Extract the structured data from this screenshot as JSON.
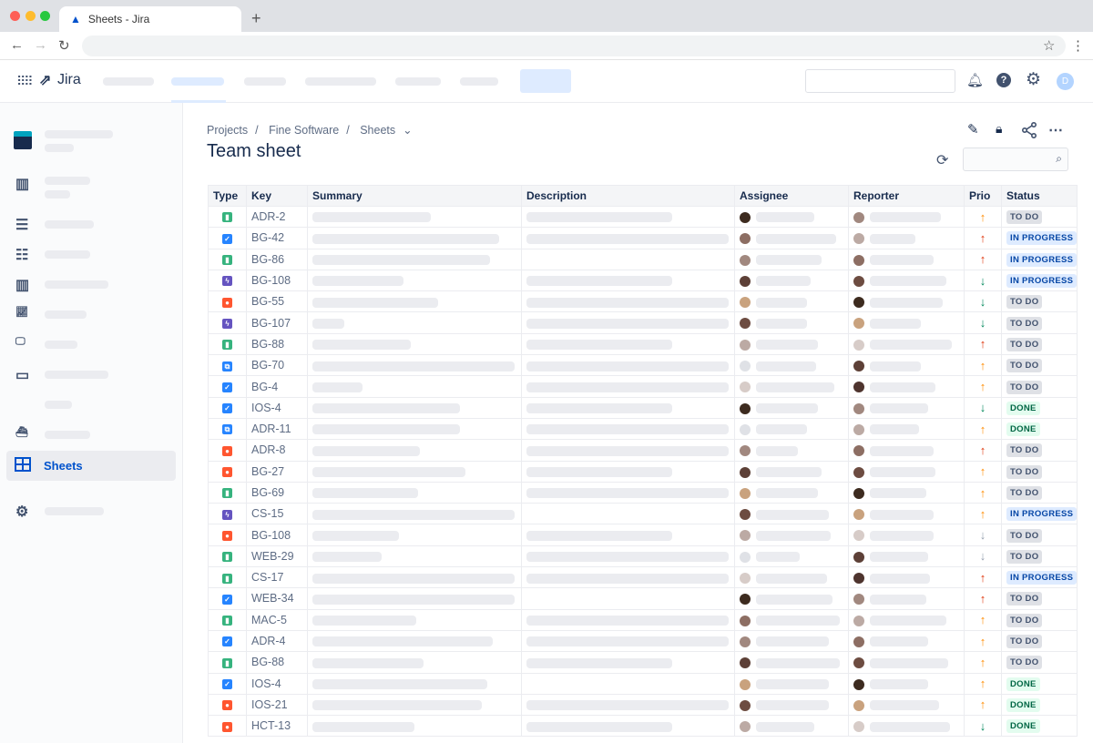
{
  "browser": {
    "tab_title": "Sheets - Jira",
    "new_tab": "+"
  },
  "app": {
    "name": "Jira",
    "avatar_initial": "D"
  },
  "sidebar": {
    "active_label": "Sheets"
  },
  "breadcrumb": {
    "items": [
      "Projects",
      "Fine Software",
      "Sheets"
    ]
  },
  "page": {
    "title": "Team sheet"
  },
  "table": {
    "columns": [
      "Type",
      "Key",
      "Summary",
      "Description",
      "Assignee",
      "Reporter",
      "Prio",
      "Status"
    ],
    "rows": [
      {
        "type": "story",
        "key": "ADR-2",
        "prio": "high",
        "status": "TO DO",
        "desc": true
      },
      {
        "type": "task",
        "key": "BG-42",
        "prio": "highest",
        "status": "IN PROGRESS",
        "desc": true
      },
      {
        "type": "story",
        "key": "BG-86",
        "prio": "highest",
        "status": "IN PROGRESS",
        "desc": false
      },
      {
        "type": "epic",
        "key": "BG-108",
        "prio": "low",
        "status": "IN PROGRESS",
        "desc": true
      },
      {
        "type": "bug",
        "key": "BG-55",
        "prio": "low",
        "status": "TO DO",
        "desc": true
      },
      {
        "type": "epic",
        "key": "BG-107",
        "prio": "low",
        "status": "TO DO",
        "desc": true
      },
      {
        "type": "story",
        "key": "BG-88",
        "prio": "highest",
        "status": "TO DO",
        "desc": true
      },
      {
        "type": "subtask",
        "key": "BG-70",
        "prio": "high",
        "status": "TO DO",
        "desc": true
      },
      {
        "type": "task",
        "key": "BG-4",
        "prio": "high",
        "status": "TO DO",
        "desc": true
      },
      {
        "type": "task",
        "key": "IOS-4",
        "prio": "low",
        "status": "DONE",
        "desc": true
      },
      {
        "type": "subtask",
        "key": "ADR-11",
        "prio": "high",
        "status": "DONE",
        "desc": true
      },
      {
        "type": "bug",
        "key": "ADR-8",
        "prio": "highest",
        "status": "TO DO",
        "desc": true
      },
      {
        "type": "bug",
        "key": "BG-27",
        "prio": "high",
        "status": "TO DO",
        "desc": true
      },
      {
        "type": "story",
        "key": "BG-69",
        "prio": "high",
        "status": "TO DO",
        "desc": true
      },
      {
        "type": "epic",
        "key": "CS-15",
        "prio": "high",
        "status": "IN PROGRESS",
        "desc": false
      },
      {
        "type": "bug",
        "key": "BG-108",
        "prio": "lowest",
        "status": "TO DO",
        "desc": true
      },
      {
        "type": "story",
        "key": "WEB-29",
        "prio": "lowest",
        "status": "TO DO",
        "desc": true
      },
      {
        "type": "story",
        "key": "CS-17",
        "prio": "highest",
        "status": "IN PROGRESS",
        "desc": true
      },
      {
        "type": "task",
        "key": "WEB-34",
        "prio": "highest",
        "status": "TO DO",
        "desc": false
      },
      {
        "type": "story",
        "key": "MAC-5",
        "prio": "high",
        "status": "TO DO",
        "desc": true
      },
      {
        "type": "task",
        "key": "ADR-4",
        "prio": "high",
        "status": "TO DO",
        "desc": true
      },
      {
        "type": "story",
        "key": "BG-88",
        "prio": "high",
        "status": "TO DO",
        "desc": true
      },
      {
        "type": "task",
        "key": "IOS-4",
        "prio": "high",
        "status": "DONE",
        "desc": false
      },
      {
        "type": "bug",
        "key": "IOS-21",
        "prio": "high",
        "status": "DONE",
        "desc": true
      },
      {
        "type": "bug",
        "key": "HCT-13",
        "prio": "low",
        "status": "DONE",
        "desc": true
      }
    ]
  },
  "colors": {
    "story": "#36b37e",
    "task": "#2684ff",
    "epic": "#6554c0",
    "bug": "#ff5630",
    "subtask": "#2684ff",
    "highest": "#de350b",
    "high": "#ff8b00",
    "low": "#00875a",
    "lowest": "#97a0af",
    "accent": "#0052cc"
  }
}
